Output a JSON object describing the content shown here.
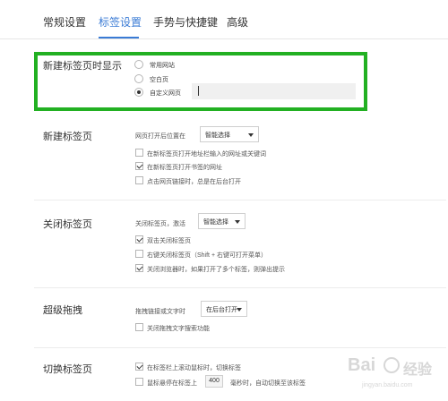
{
  "tabs": [
    {
      "label": "常规设置",
      "active": false
    },
    {
      "label": "标签设置",
      "active": true
    },
    {
      "label": "手势与快捷键",
      "active": false
    },
    {
      "label": "高级",
      "active": false
    }
  ],
  "accent_color": "#3a7bd5",
  "highlight_color": "#22b022",
  "new_tab_page": {
    "title": "新建标签页时显示",
    "options": [
      "常用网站",
      "空白页",
      "自定义网页"
    ],
    "selected": "自定义网页",
    "custom_url": ""
  },
  "new_tab": {
    "title": "新建标签页",
    "position_label": "网页打开后位置在",
    "position_value": "智能选择",
    "checkboxes": [
      {
        "label": "在新标签页打开地址栏输入的网址或关键词",
        "checked": false
      },
      {
        "label": "在新标签页打开书签的网址",
        "checked": true
      },
      {
        "label": "点击网页链接时，总是在后台打开",
        "checked": false
      }
    ]
  },
  "close_tab": {
    "title": "关闭标签页",
    "activate_label": "关闭标签页，激活",
    "activate_value": "智能选择",
    "checkboxes": [
      {
        "label": "双击关闭标签页",
        "checked": true
      },
      {
        "label": "右键关闭标签页（Shift + 右键可打开菜单）",
        "checked": false
      },
      {
        "label": "关闭浏览器时，如果打开了多个标签，则弹出提示",
        "checked": true
      }
    ]
  },
  "super_drag": {
    "title": "超级拖拽",
    "drag_label": "拖拽链接或文字时",
    "drag_value": "在后台打开",
    "checkboxes": [
      {
        "label": "关闭拖拽文字搜索功能",
        "checked": false
      }
    ]
  },
  "switch_tab": {
    "title": "切换标签页",
    "checkboxes": [
      {
        "label": "在标签栏上滚动鼠标时，切换标签",
        "checked": true
      }
    ],
    "hover_prefix": "鼠标悬停在标签上",
    "hover_ms": "400",
    "hover_suffix": "毫秒时，自动切换至该标签",
    "hover_checked": false
  },
  "watermark": {
    "text": "Bai",
    "cn": "经验",
    "url": "jingyan.baidu.com"
  }
}
